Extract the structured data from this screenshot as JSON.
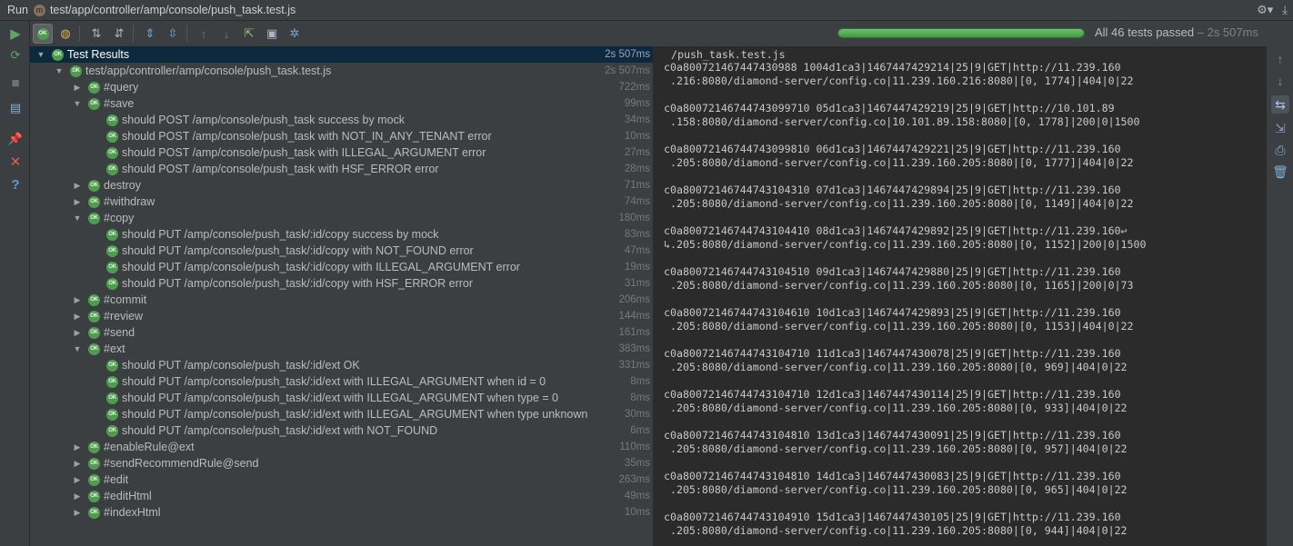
{
  "titlebar": {
    "run_label": "Run",
    "config_icon_letter": "m",
    "path": "test/app/controller/amp/console/push_task.test.js"
  },
  "status": {
    "text": "All 46 tests passed",
    "separator": " – ",
    "duration": "2s 507ms",
    "progress": 1.0
  },
  "tree": {
    "ok_badge": "OK",
    "rows": [
      {
        "label": "Test Results",
        "time": "2s 507ms",
        "indent": 0,
        "arrow": "▼",
        "selected": true
      },
      {
        "label": "test/app/controller/amp/console/push_task.test.js",
        "time": "2s 507ms",
        "indent": 1,
        "arrow": "▼"
      },
      {
        "label": "#query",
        "time": "722ms",
        "indent": 2,
        "arrow": "▶"
      },
      {
        "label": "#save",
        "time": "99ms",
        "indent": 2,
        "arrow": "▼"
      },
      {
        "label": "should POST /amp/console/push_task success by mock",
        "time": "34ms",
        "indent": 3,
        "arrow": ""
      },
      {
        "label": "should POST /amp/console/push_task with NOT_IN_ANY_TENANT error",
        "time": "10ms",
        "indent": 3,
        "arrow": ""
      },
      {
        "label": "should POST /amp/console/push_task with ILLEGAL_ARGUMENT error",
        "time": "27ms",
        "indent": 3,
        "arrow": ""
      },
      {
        "label": "should POST /amp/console/push_task with HSF_ERROR error",
        "time": "28ms",
        "indent": 3,
        "arrow": ""
      },
      {
        "label": "destroy",
        "time": "71ms",
        "indent": 2,
        "arrow": "▶"
      },
      {
        "label": "#withdraw",
        "time": "74ms",
        "indent": 2,
        "arrow": "▶"
      },
      {
        "label": "#copy",
        "time": "180ms",
        "indent": 2,
        "arrow": "▼"
      },
      {
        "label": "should PUT /amp/console/push_task/:id/copy success by mock",
        "time": "83ms",
        "indent": 3,
        "arrow": ""
      },
      {
        "label": "should PUT /amp/console/push_task/:id/copy with NOT_FOUND error",
        "time": "47ms",
        "indent": 3,
        "arrow": ""
      },
      {
        "label": "should PUT /amp/console/push_task/:id/copy with ILLEGAL_ARGUMENT error",
        "time": "19ms",
        "indent": 3,
        "arrow": ""
      },
      {
        "label": "should PUT /amp/console/push_task/:id/copy with HSF_ERROR error",
        "time": "31ms",
        "indent": 3,
        "arrow": ""
      },
      {
        "label": "#commit",
        "time": "206ms",
        "indent": 2,
        "arrow": "▶"
      },
      {
        "label": "#review",
        "time": "144ms",
        "indent": 2,
        "arrow": "▶"
      },
      {
        "label": "#send",
        "time": "161ms",
        "indent": 2,
        "arrow": "▶"
      },
      {
        "label": "#ext",
        "time": "383ms",
        "indent": 2,
        "arrow": "▼"
      },
      {
        "label": "should PUT /amp/console/push_task/:id/ext OK",
        "time": "331ms",
        "indent": 3,
        "arrow": ""
      },
      {
        "label": "should PUT /amp/console/push_task/:id/ext with ILLEGAL_ARGUMENT when id = 0",
        "time": "8ms",
        "indent": 3,
        "arrow": ""
      },
      {
        "label": "should PUT /amp/console/push_task/:id/ext with ILLEGAL_ARGUMENT when type = 0",
        "time": "8ms",
        "indent": 3,
        "arrow": ""
      },
      {
        "label": "should PUT /amp/console/push_task/:id/ext with ILLEGAL_ARGUMENT when type unknown",
        "time": "30ms",
        "indent": 3,
        "arrow": ""
      },
      {
        "label": "should PUT /amp/console/push_task/:id/ext with NOT_FOUND",
        "time": "6ms",
        "indent": 3,
        "arrow": ""
      },
      {
        "label": "#enableRule@ext",
        "time": "110ms",
        "indent": 2,
        "arrow": "▶"
      },
      {
        "label": "#sendRecommendRule@send",
        "time": "35ms",
        "indent": 2,
        "arrow": "▶"
      },
      {
        "label": "#edit",
        "time": "263ms",
        "indent": 2,
        "arrow": "▶"
      },
      {
        "label": "#editHtml",
        "time": "49ms",
        "indent": 2,
        "arrow": "▶"
      },
      {
        "label": "#indexHtml",
        "time": "10ms",
        "indent": 2,
        "arrow": "▶"
      }
    ]
  },
  "console": {
    "header": "/push_task.test.js",
    "entries": [
      [
        "c0a800721467447430988 1004d1ca3|1467447429214|25|9|GET|http://11.239.160",
        " .216:8080/diamond-server/config.co|11.239.160.216:8080|[0, 1774]|404|0|22"
      ],
      [
        "c0a80072146744743099710 05d1ca3|1467447429219|25|9|GET|http://10.101.89",
        " .158:8080/diamond-server/config.co|10.101.89.158:8080|[0, 1778]|200|0|1500"
      ],
      [
        "c0a80072146744743099810 06d1ca3|1467447429221|25|9|GET|http://11.239.160",
        " .205:8080/diamond-server/config.co|11.239.160.205:8080|[0, 1777]|404|0|22"
      ],
      [
        "c0a80072146744743104310 07d1ca3|1467447429894|25|9|GET|http://11.239.160",
        " .205:8080/diamond-server/config.co|11.239.160.205:8080|[0, 1149]|404|0|22"
      ],
      [
        "c0a80072146744743104410 08d1ca3|1467447429892|25|9|GET|http://11.239.160↩",
        "↳.205:8080/diamond-server/config.co|11.239.160.205:8080|[0, 1152]|200|0|1500"
      ],
      [
        "c0a80072146744743104510 09d1ca3|1467447429880|25|9|GET|http://11.239.160",
        " .205:8080/diamond-server/config.co|11.239.160.205:8080|[0, 1165]|200|0|73"
      ],
      [
        "c0a80072146744743104610 10d1ca3|1467447429893|25|9|GET|http://11.239.160",
        " .205:8080/diamond-server/config.co|11.239.160.205:8080|[0, 1153]|404|0|22"
      ],
      [
        "c0a80072146744743104710 11d1ca3|1467447430078|25|9|GET|http://11.239.160",
        " .205:8080/diamond-server/config.co|11.239.160.205:8080|[0, 969]|404|0|22"
      ],
      [
        "c0a80072146744743104710 12d1ca3|1467447430114|25|9|GET|http://11.239.160",
        " .205:8080/diamond-server/config.co|11.239.160.205:8080|[0, 933]|404|0|22"
      ],
      [
        "c0a80072146744743104810 13d1ca3|1467447430091|25|9|GET|http://11.239.160",
        " .205:8080/diamond-server/config.co|11.239.160.205:8080|[0, 957]|404|0|22"
      ],
      [
        "c0a80072146744743104810 14d1ca3|1467447430083|25|9|GET|http://11.239.160",
        " .205:8080/diamond-server/config.co|11.239.160.205:8080|[0, 965]|404|0|22"
      ],
      [
        "c0a80072146744743104910 15d1ca3|1467447430105|25|9|GET|http://11.239.160",
        " .205:8080/diamond-server/config.co|11.239.160.205:8080|[0, 944]|404|0|22"
      ]
    ]
  },
  "colors": {
    "ok_green": "#4e9d4e",
    "progress_green": "#5cb85c",
    "selection": "#0d293e",
    "console_bg": "#2b2b2b",
    "panel_bg": "#3c3f41"
  },
  "icons": {
    "toolbar": [
      "rerun-icon",
      "show-passed-icon",
      "show-ignored-icon",
      "sort-alpha-icon",
      "sort-duration-icon",
      "expand-all-icon",
      "collapse-all-icon",
      "prev-failed-icon",
      "next-failed-icon",
      "export-icon",
      "import-icon",
      "settings-icon"
    ],
    "side": [
      "run-icon",
      "rerun-failed-icon",
      "stop-icon",
      "layout-icon",
      "pin-icon",
      "close-icon",
      "help-icon"
    ],
    "right": [
      "scroll-up-icon",
      "scroll-down-icon",
      "soft-wrap-icon",
      "scroll-to-end-icon",
      "print-icon",
      "clear-icon"
    ]
  }
}
